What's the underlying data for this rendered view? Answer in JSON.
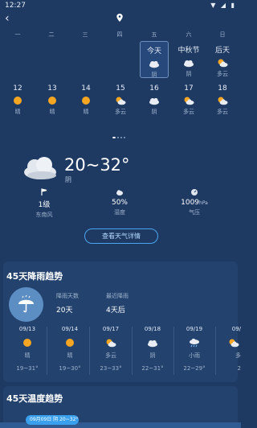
{
  "status": {
    "time": "12:27",
    "icons": "▼ ◢ ▮"
  },
  "nav": {
    "back_glyph": "‹"
  },
  "calendar": {
    "weekdays": [
      "一",
      "二",
      "三",
      "四",
      "五",
      "六",
      "日"
    ],
    "top_row": [
      {
        "label": "今天",
        "cond": "阴",
        "icon": "cloudy-icon",
        "selected": true
      },
      {
        "label": "中秋节",
        "cond": "阴",
        "icon": "cloudy-icon",
        "selected": false
      },
      {
        "label": "后天",
        "cond": "多云",
        "icon": "partly-cloudy-icon",
        "selected": false
      }
    ],
    "bottom_row": [
      {
        "num": "12",
        "cond": "晴",
        "icon": "sun-icon"
      },
      {
        "num": "13",
        "cond": "晴",
        "icon": "sun-icon"
      },
      {
        "num": "14",
        "cond": "晴",
        "icon": "sun-icon"
      },
      {
        "num": "15",
        "cond": "多云",
        "icon": "partly-cloudy-icon"
      },
      {
        "num": "16",
        "cond": "阴",
        "icon": "cloudy-icon"
      },
      {
        "num": "17",
        "cond": "多云",
        "icon": "partly-cloudy-icon"
      },
      {
        "num": "18",
        "cond": "多云",
        "icon": "partly-cloudy-icon"
      }
    ]
  },
  "today": {
    "temp": "20~32°",
    "cond": "阴",
    "wind": {
      "value": "1级",
      "label": "东南风"
    },
    "humidity": {
      "value": "50%",
      "label": "湿度"
    },
    "pressure": {
      "value": "1009",
      "unit": "hPa",
      "label": "气压"
    },
    "detail_button": "查看天气详情"
  },
  "rain_trend": {
    "title": "45天降雨趋势",
    "rain_days_label": "降雨天数",
    "rain_days_value": "20天",
    "recent_rain_label": "最近降雨",
    "recent_rain_value": "4天后",
    "forecast": [
      {
        "date": "09/13",
        "cond": "晴",
        "temp": "19~31°",
        "icon": "sun-icon"
      },
      {
        "date": "09/14",
        "cond": "晴",
        "temp": "19~30°",
        "icon": "sun-icon"
      },
      {
        "date": "09/17",
        "cond": "多云",
        "temp": "23~33°",
        "icon": "partly-cloudy-icon"
      },
      {
        "date": "09/18",
        "cond": "阴",
        "temp": "22~31°",
        "icon": "cloudy-icon"
      },
      {
        "date": "09/19",
        "cond": "小雨",
        "temp": "22~29°",
        "icon": "rain-icon"
      },
      {
        "date": "09/",
        "cond": "多",
        "temp": "2",
        "icon": "partly-cloudy-icon"
      }
    ]
  },
  "temp_trend": {
    "title": "45天温度趋势",
    "chip": "09月09日 阴 20~32°"
  },
  "colors": {
    "background": "#1e3a63",
    "card": "#23426e",
    "accent": "#3aa0ee",
    "sun": "#f6a623"
  }
}
